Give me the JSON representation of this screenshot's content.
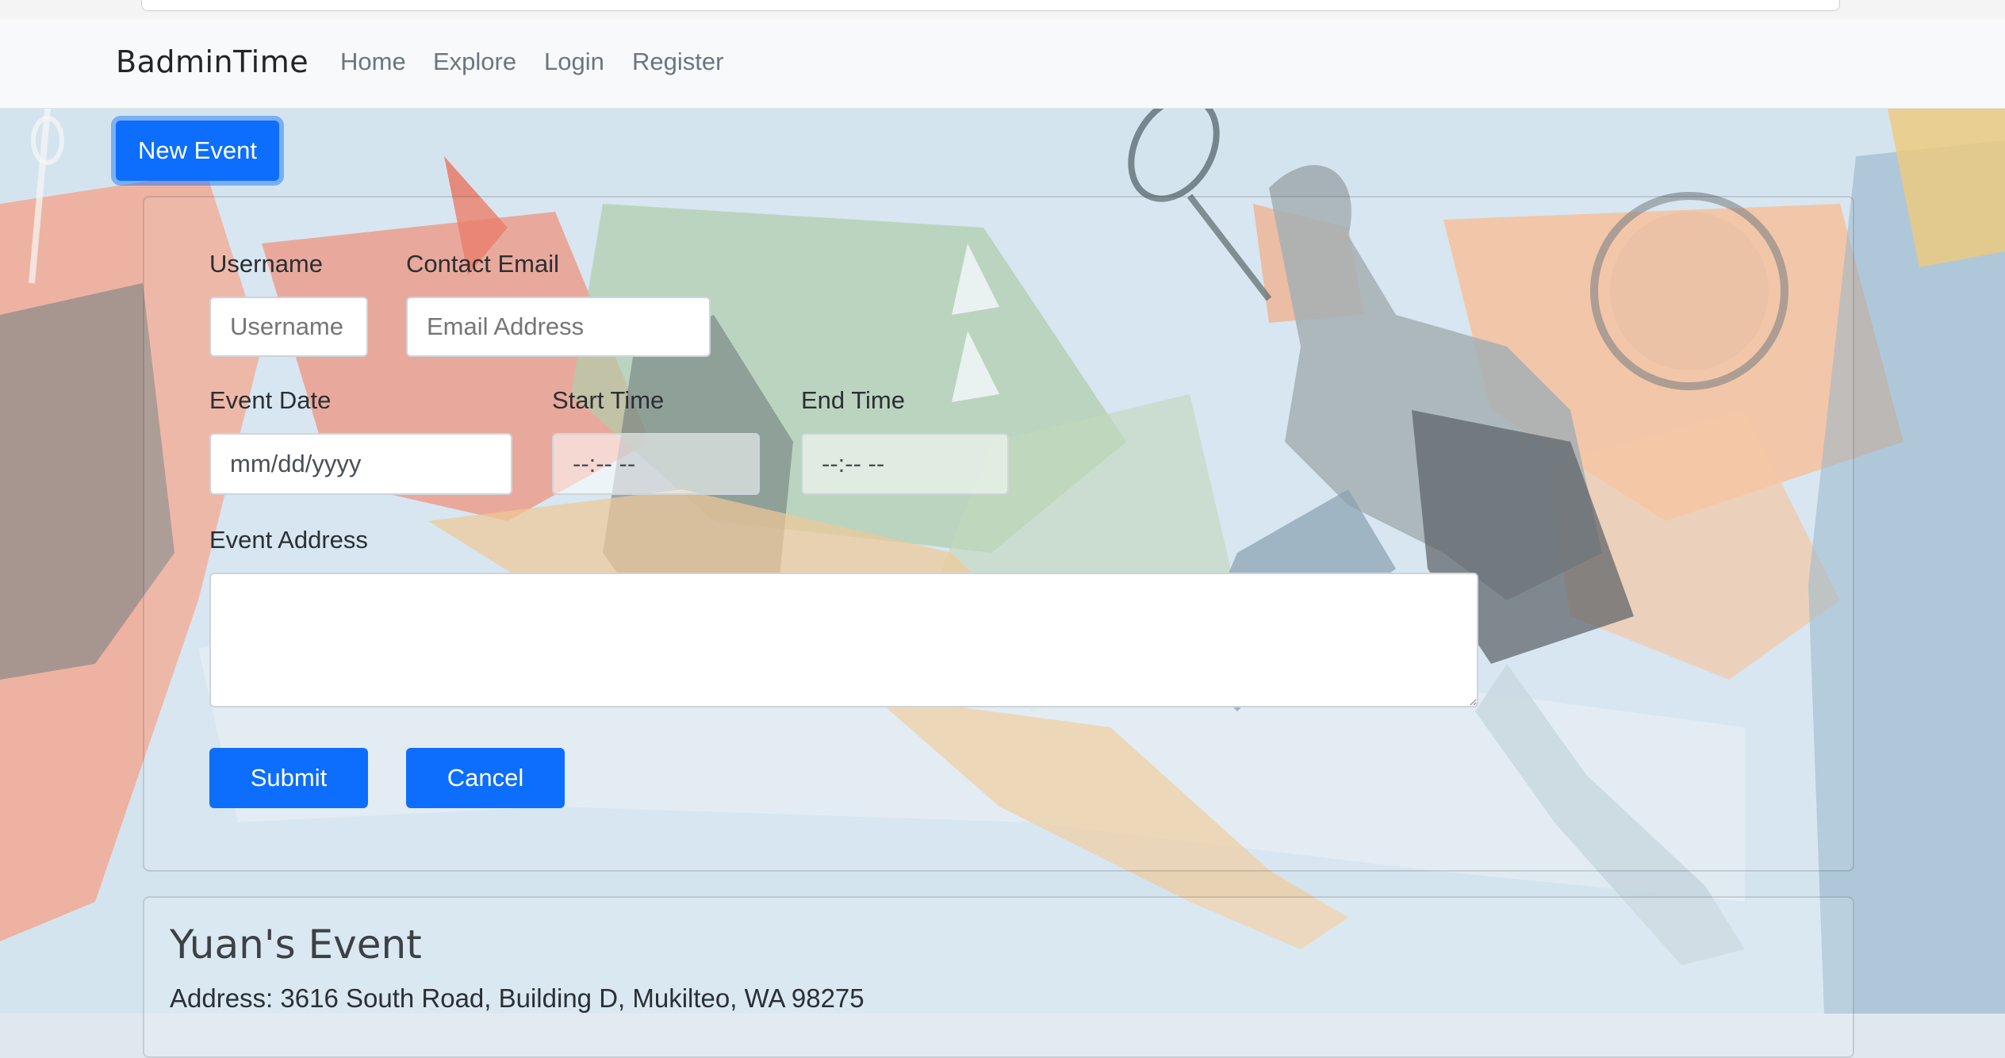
{
  "navbar": {
    "brand": "BadminTime",
    "links": [
      "Home",
      "Explore",
      "Login",
      "Register"
    ]
  },
  "new_event_button": "New Event",
  "form": {
    "username_label": "Username",
    "username_placeholder": "Username",
    "email_label": "Contact Email",
    "email_placeholder": "Email Address",
    "date_label": "Event Date",
    "date_placeholder": "mm/dd/yyyy",
    "start_label": "Start Time",
    "start_placeholder": "--:-- --",
    "end_label": "End Time",
    "end_placeholder": "--:-- --",
    "address_label": "Event Address",
    "address_value": "",
    "submit": "Submit",
    "cancel": "Cancel"
  },
  "event": {
    "title": "Yuan's Event",
    "address": "Address: 3616 South Road, Building D, Mukilteo, WA 98275"
  },
  "colors": {
    "primary": "#0d6efd",
    "navbar_bg": "#f8f9fa"
  }
}
